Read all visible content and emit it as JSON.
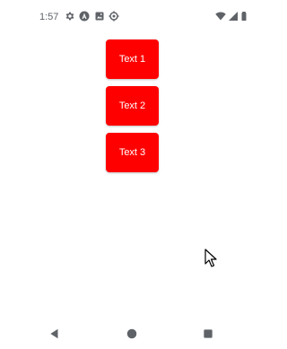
{
  "status_bar": {
    "time": "1:57",
    "left_icons": [
      "settings-icon",
      "a-badge-icon",
      "photo-icon",
      "debug-icon"
    ],
    "right_icons": [
      "wifi-icon",
      "cellular-signal-icon",
      "battery-icon"
    ],
    "icon_color": "#5f6368"
  },
  "buttons": [
    {
      "label": "Text 1"
    },
    {
      "label": "Text 2"
    },
    {
      "label": "Text 3"
    }
  ],
  "button_color": "#ff0000",
  "button_text_color": "#ffffff",
  "navigation_bar": {
    "items": [
      "back-icon",
      "home-icon",
      "recents-icon"
    ],
    "icon_color": "#5f6368"
  }
}
